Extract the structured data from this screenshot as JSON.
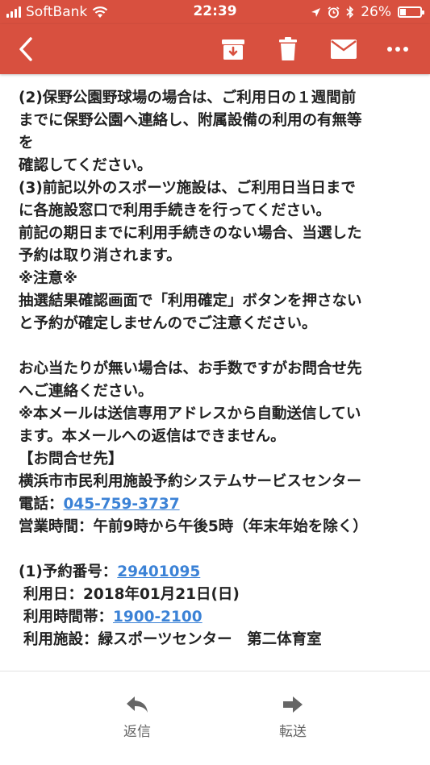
{
  "status_bar": {
    "carrier": "SoftBank",
    "time": "22:39",
    "battery": "26%",
    "battery_level": 0.26,
    "icons": [
      "signal-icon",
      "wifi-icon",
      "location-icon",
      "alarm-icon",
      "bluetooth-icon",
      "battery-icon"
    ]
  },
  "toolbar": {
    "icons": [
      "back-icon",
      "archive-icon",
      "trash-icon",
      "mail-icon",
      "more-icon"
    ],
    "color": "#d8503f"
  },
  "body": {
    "l1": "(2)保野公園野球場の場合は、ご利用日の１週間前",
    "l2": "までに保野公園へ連絡し、附属設備の利用の有無等",
    "l3": "を",
    "l4": "確認してください。",
    "l5": "(3)前記以外のスポーツ施設は、ご利用日当日まで",
    "l6": "に各施設窓口で利用手続きを行ってください。",
    "l7": "前記の期日までに利用手続きのない場合、当選した",
    "l8": "予約は取り消されます。",
    "l9": "※注意※",
    "l10": "抽選結果確認画面で「利用確定」ボタンを押さない",
    "l11": "と予約が確定しませんのでご注意ください。",
    "l12": "お心当たりが無い場合は、お手数ですがお問合せ先",
    "l13": "へご連絡ください。",
    "l14": "※本メールは送信専用アドレスから自動送信してい",
    "l15": "ます。本メールへの返信はできません。",
    "l16": "【お問合せ先】",
    "l17": "横浜市市民利用施設予約システムサービスセンター",
    "tel_label": "電話：",
    "tel_number": "045-759-3737",
    "hours": "営業時間：午前9時から午後5時（年末年始を除く）",
    "res_label": "(1)予約番号：",
    "res_number": "29401095",
    "use_date": "利用日：2018年01月21日(日)",
    "time_label": "利用時間帯：",
    "time_value": "1900-2100",
    "facility": "利用施設：緑スポーツセンター　第二体育室"
  },
  "bottom": {
    "reply_label": "返信",
    "forward_label": "転送"
  }
}
